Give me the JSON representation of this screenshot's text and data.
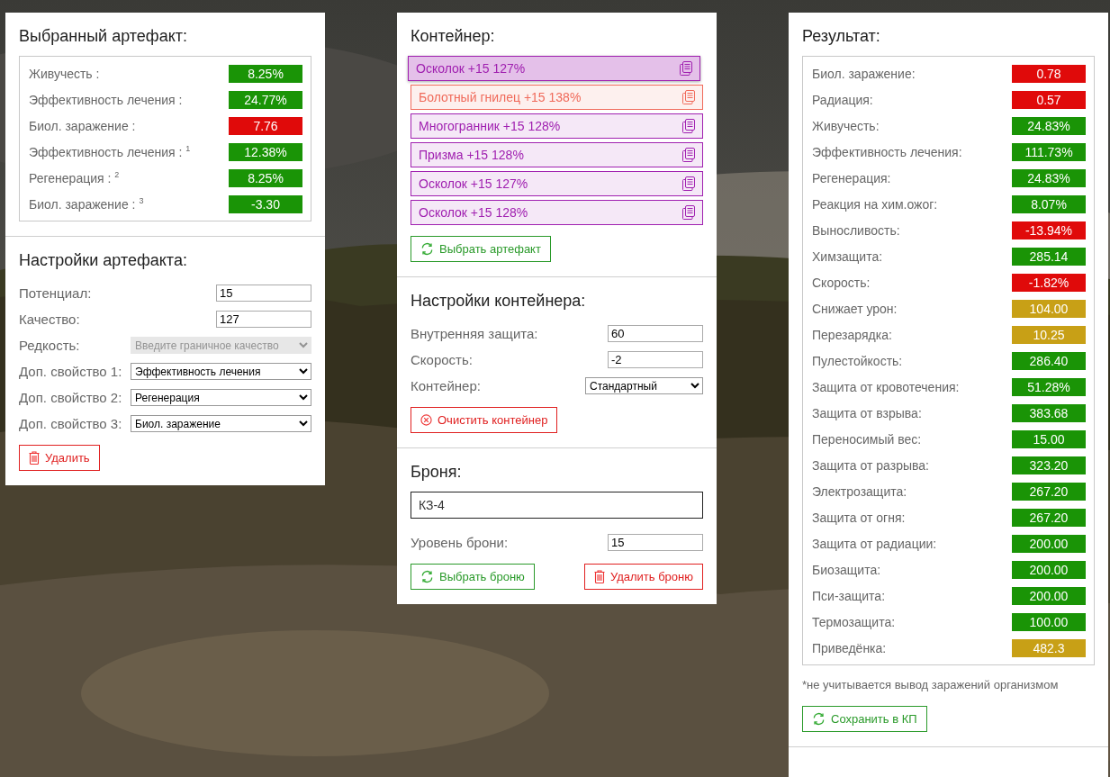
{
  "artifact": {
    "title": "Выбранный артефакт:",
    "stats": [
      {
        "label": "Живучесть :",
        "value": "8.25%",
        "color": "#1a9406"
      },
      {
        "label": "Эффективность лечения :",
        "value": "24.77%",
        "color": "#1a9406"
      },
      {
        "label": "Биол. заражение :",
        "value": "7.76",
        "color": "#e00a0a"
      },
      {
        "label": "Эффективность лечения : $^{1}$",
        "value": "12.38%",
        "color": "#1a9406"
      },
      {
        "label": "Регенерация : $^{2}$",
        "value": "8.25%",
        "color": "#1a9406"
      },
      {
        "label": "Биол. заражение : $^{3}$",
        "value": "-3.30",
        "color": "#1a9406"
      }
    ]
  },
  "artifact_settings": {
    "title": "Настройки артефакта:",
    "fields": [
      {
        "kind": "input",
        "label": "Потенциал:",
        "value": "15",
        "disabled": false
      },
      {
        "kind": "input",
        "label": "Качество:",
        "value": "127",
        "disabled": false
      },
      {
        "kind": "select",
        "label": "Редкость:",
        "value": "Введите граничное качество",
        "disabled": true
      },
      {
        "kind": "select",
        "label": "Доп. свойство 1:",
        "value": "Эффективность лечения",
        "disabled": false
      },
      {
        "kind": "select",
        "label": "Доп. свойство 2:",
        "value": "Регенерация",
        "disabled": false
      },
      {
        "kind": "select",
        "label": "Доп. свойство 3:",
        "value": "Биол. заражение",
        "disabled": false
      }
    ],
    "delete_button": "Удалить"
  },
  "container": {
    "title": "Контейнер:",
    "items": [
      {
        "label": "Осколок +15 127%",
        "color": "#a020b0",
        "selected": true
      },
      {
        "label": "Болотный гнилец +15 138%",
        "color": "#f06a5a",
        "selected": false
      },
      {
        "label": "Многогранник +15 128%",
        "color": "#a020b0",
        "selected": false
      },
      {
        "label": "Призма +15 128%",
        "color": "#a020b0",
        "selected": false
      },
      {
        "label": "Осколок +15 127%",
        "color": "#a020b0",
        "selected": false
      },
      {
        "label": "Осколок +15 128%",
        "color": "#a020b0",
        "selected": false
      }
    ],
    "choose_button": "Выбрать артефакт"
  },
  "container_settings": {
    "title": "Настройки контейнера:",
    "fields": [
      {
        "kind": "input",
        "label": "Внутренняя защита:",
        "value": "60",
        "disabled": false
      },
      {
        "kind": "input",
        "label": "Скорость:",
        "value": "-2",
        "disabled": false
      },
      {
        "kind": "select",
        "label": "Контейнер:",
        "value": "Стандартный",
        "disabled": false
      }
    ],
    "clear_button": "Очистить контейнер"
  },
  "armor": {
    "title": "Броня:",
    "name": "КЗ-4",
    "level_label": "Уровень брони:",
    "level_value": "15",
    "choose_button": "Выбрать броню",
    "delete_button": "Удалить броню"
  },
  "result": {
    "title": "Результат:",
    "stats": [
      {
        "label": "Биол. заражение:",
        "value": "0.78",
        "color": "#e00a0a"
      },
      {
        "label": "Радиация:",
        "value": "0.57",
        "color": "#e00a0a"
      },
      {
        "label": "Живучесть:",
        "value": "24.83%",
        "color": "#1a9406"
      },
      {
        "label": "Эффективность лечения:",
        "value": "111.73%",
        "color": "#1a9406"
      },
      {
        "label": "Регенерация:",
        "value": "24.83%",
        "color": "#1a9406"
      },
      {
        "label": "Реакция на хим.ожог:",
        "value": "8.07%",
        "color": "#1a9406"
      },
      {
        "label": "Выносливость:",
        "value": "-13.94%",
        "color": "#e00a0a"
      },
      {
        "label": "Химзащита:",
        "value": "285.14",
        "color": "#1a9406"
      },
      {
        "label": "Скорость:",
        "value": "-1.82%",
        "color": "#e00a0a"
      },
      {
        "label": "Снижает урон:",
        "value": "104.00",
        "color": "#c8a016"
      },
      {
        "label": "Перезарядка:",
        "value": "10.25",
        "color": "#c8a016"
      },
      {
        "label": "Пулестойкость:",
        "value": "286.40",
        "color": "#1a9406"
      },
      {
        "label": "Защита от кровотечения:",
        "value": "51.28%",
        "color": "#1a9406"
      },
      {
        "label": "Защита от взрыва:",
        "value": "383.68",
        "color": "#1a9406"
      },
      {
        "label": "Переносимый вес:",
        "value": "15.00",
        "color": "#1a9406"
      },
      {
        "label": "Защита от разрыва:",
        "value": "323.20",
        "color": "#1a9406"
      },
      {
        "label": "Электрозащита:",
        "value": "267.20",
        "color": "#1a9406"
      },
      {
        "label": "Защита от огня:",
        "value": "267.20",
        "color": "#1a9406"
      },
      {
        "label": "Защита от радиации:",
        "value": "200.00",
        "color": "#1a9406"
      },
      {
        "label": "Биозащита:",
        "value": "200.00",
        "color": "#1a9406"
      },
      {
        "label": "Пси-защита:",
        "value": "200.00",
        "color": "#1a9406"
      },
      {
        "label": "Термозащита:",
        "value": "100.00",
        "color": "#1a9406"
      },
      {
        "label": "Приведёнка:",
        "value": "482.3",
        "color": "#c8a016"
      }
    ],
    "note": "*не учитывается вывод заражений организмом",
    "save_button": "Сохранить в КП"
  }
}
